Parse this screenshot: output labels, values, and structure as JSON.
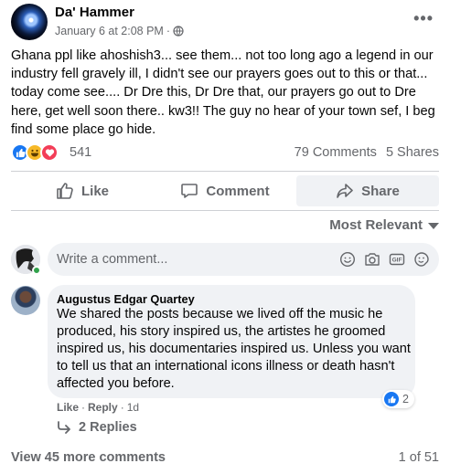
{
  "post": {
    "author": "Da' Hammer",
    "date": "January 6 at 2:08 PM",
    "separator": "·",
    "audience_icon": "globe-icon",
    "more_label": "•••",
    "text": "Ghana ppl like ahoshish3... see them... not too long ago a legend in our industry fell gravely ill, I didn't see our prayers goes out to this or that... today come see.... Dr Dre this, Dr Dre that, our prayers go out to Dre here, get well soon there.. kw3!! The guy no hear of your town sef, I beg find some place go hide."
  },
  "reactions": {
    "icons": [
      "like-icon",
      "haha-icon",
      "love-icon"
    ],
    "count": "541",
    "comments": "79 Comments",
    "shares": "5 Shares"
  },
  "actions": {
    "like": "Like",
    "comment": "Comment",
    "share": "Share"
  },
  "sort": {
    "label": "Most Relevant"
  },
  "composer": {
    "placeholder": "Write a comment...",
    "tools": [
      "emoji-icon",
      "camera-icon",
      "gif-icon",
      "sticker-icon"
    ]
  },
  "comment": {
    "author": "Augustus Edgar Quartey",
    "text": "We shared the posts because we lived off the music he produced, his story inspired us, the artistes he groomed inspired us, his documentaries inspired us. Unless you want to tell us that an international icons illness or death hasn't affected you before.",
    "like_label": "Like",
    "reply_label": "Reply",
    "time": "1d",
    "dot": "·",
    "reaction_count": "2",
    "replies_label": "2 Replies"
  },
  "footer": {
    "view_more": "View 45 more comments",
    "pager": "1 of 51"
  },
  "colors": {
    "accent": "#1877f2",
    "secondary_text": "#65676b",
    "bubble_bg": "#f0f2f5",
    "love": "#f33e58",
    "haha": "#f7b928",
    "online": "#31a24c"
  }
}
